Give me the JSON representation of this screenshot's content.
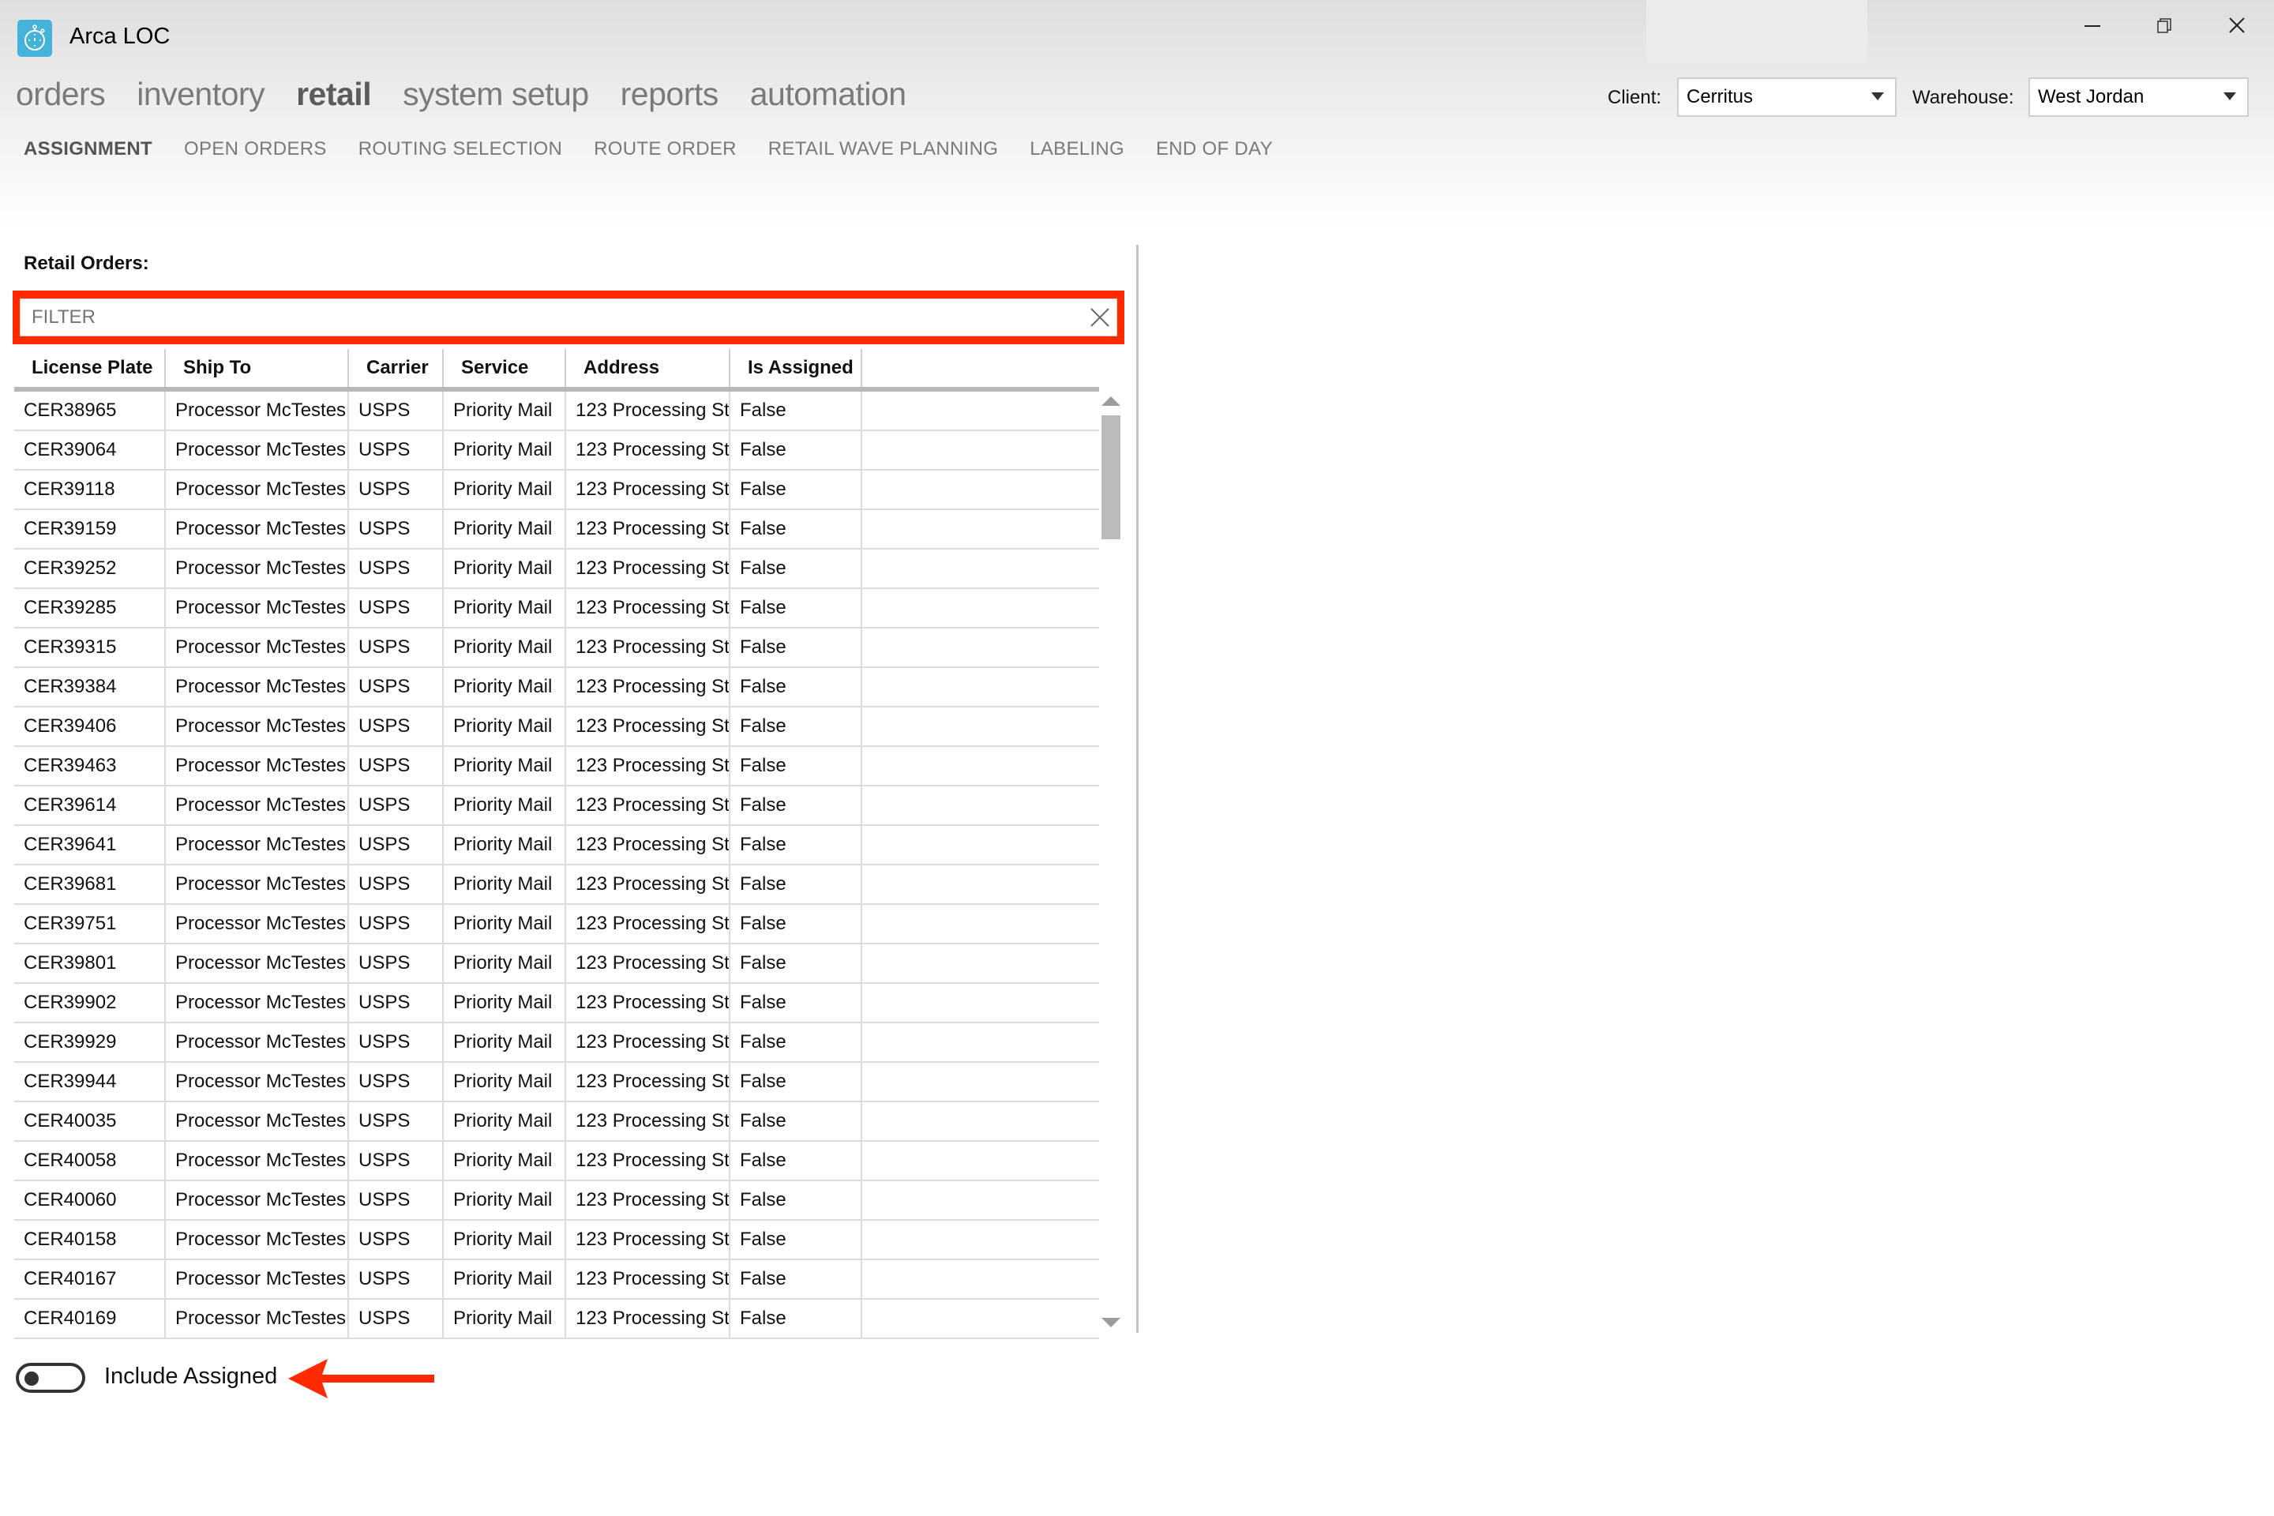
{
  "app": {
    "title": "Arca LOC",
    "icon": "stopwatch-icon",
    "window_controls": {
      "minimize": "minimize-icon",
      "restore": "restore-icon",
      "close": "close-icon"
    }
  },
  "nav": {
    "items": [
      {
        "label": "orders",
        "active": false
      },
      {
        "label": "inventory",
        "active": false
      },
      {
        "label": "retail",
        "active": true
      },
      {
        "label": "system setup",
        "active": false
      },
      {
        "label": "reports",
        "active": false
      },
      {
        "label": "automation",
        "active": false
      }
    ]
  },
  "tabs": {
    "items": [
      {
        "label": "ASSIGNMENT",
        "active": true
      },
      {
        "label": "OPEN ORDERS",
        "active": false
      },
      {
        "label": "ROUTING SELECTION",
        "active": false
      },
      {
        "label": "ROUTE ORDER",
        "active": false
      },
      {
        "label": "RETAIL WAVE PLANNING",
        "active": false
      },
      {
        "label": "LABELING",
        "active": false
      },
      {
        "label": "END OF DAY",
        "active": false
      }
    ]
  },
  "selectors": {
    "client": {
      "label": "Client:",
      "value": "Cerritus"
    },
    "warehouse": {
      "label": "Warehouse:",
      "value": "West Jordan"
    }
  },
  "retail_orders": {
    "label": "Retail Orders:",
    "filter": {
      "placeholder": "FILTER",
      "value": ""
    },
    "columns": [
      "License Plate",
      "Ship To",
      "Carrier",
      "Service",
      "Address",
      "Is Assigned"
    ],
    "rows": [
      [
        "CER38965",
        "Processor McTestes",
        "USPS",
        "Priority Mail",
        "123 Processing St",
        "False"
      ],
      [
        "CER39064",
        "Processor McTestes",
        "USPS",
        "Priority Mail",
        "123 Processing St",
        "False"
      ],
      [
        "CER39118",
        "Processor McTestes",
        "USPS",
        "Priority Mail",
        "123 Processing St",
        "False"
      ],
      [
        "CER39159",
        "Processor McTestes",
        "USPS",
        "Priority Mail",
        "123 Processing St",
        "False"
      ],
      [
        "CER39252",
        "Processor McTestes",
        "USPS",
        "Priority Mail",
        "123 Processing St",
        "False"
      ],
      [
        "CER39285",
        "Processor McTestes",
        "USPS",
        "Priority Mail",
        "123 Processing St",
        "False"
      ],
      [
        "CER39315",
        "Processor McTestes",
        "USPS",
        "Priority Mail",
        "123 Processing St",
        "False"
      ],
      [
        "CER39384",
        "Processor McTestes",
        "USPS",
        "Priority Mail",
        "123 Processing St",
        "False"
      ],
      [
        "CER39406",
        "Processor McTestes",
        "USPS",
        "Priority Mail",
        "123 Processing St",
        "False"
      ],
      [
        "CER39463",
        "Processor McTestes",
        "USPS",
        "Priority Mail",
        "123 Processing St",
        "False"
      ],
      [
        "CER39614",
        "Processor McTestes",
        "USPS",
        "Priority Mail",
        "123 Processing St",
        "False"
      ],
      [
        "CER39641",
        "Processor McTestes",
        "USPS",
        "Priority Mail",
        "123 Processing St",
        "False"
      ],
      [
        "CER39681",
        "Processor McTestes",
        "USPS",
        "Priority Mail",
        "123 Processing St",
        "False"
      ],
      [
        "CER39751",
        "Processor McTestes",
        "USPS",
        "Priority Mail",
        "123 Processing St",
        "False"
      ],
      [
        "CER39801",
        "Processor McTestes",
        "USPS",
        "Priority Mail",
        "123 Processing St",
        "False"
      ],
      [
        "CER39902",
        "Processor McTestes",
        "USPS",
        "Priority Mail",
        "123 Processing St",
        "False"
      ],
      [
        "CER39929",
        "Processor McTestes",
        "USPS",
        "Priority Mail",
        "123 Processing St",
        "False"
      ],
      [
        "CER39944",
        "Processor McTestes",
        "USPS",
        "Priority Mail",
        "123 Processing St",
        "False"
      ],
      [
        "CER40035",
        "Processor McTestes",
        "USPS",
        "Priority Mail",
        "123 Processing St",
        "False"
      ],
      [
        "CER40058",
        "Processor McTestes",
        "USPS",
        "Priority Mail",
        "123 Processing St",
        "False"
      ],
      [
        "CER40060",
        "Processor McTestes",
        "USPS",
        "Priority Mail",
        "123 Processing St",
        "False"
      ],
      [
        "CER40158",
        "Processor McTestes",
        "USPS",
        "Priority Mail",
        "123 Processing St",
        "False"
      ],
      [
        "CER40167",
        "Processor McTestes",
        "USPS",
        "Priority Mail",
        "123 Processing St",
        "False"
      ],
      [
        "CER40169",
        "Processor McTestes",
        "USPS",
        "Priority Mail",
        "123 Processing St",
        "False"
      ]
    ]
  },
  "include_assigned": {
    "label": "Include Assigned",
    "checked": false
  },
  "annotations": {
    "highlight_color": "#ff2a00",
    "arrow_color": "#ff2a00"
  },
  "colors": {
    "accent": "#45b2d9"
  }
}
